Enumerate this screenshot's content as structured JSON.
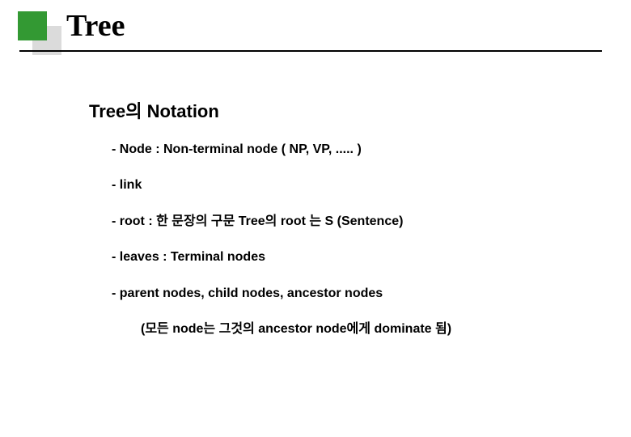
{
  "title": "Tree",
  "subtitle": "Tree의  Notation",
  "items": [
    "- Node :  Non-terminal node ( NP, VP, ..... )",
    "- link",
    "- root  :  한 문장의 구문 Tree의  root 는 S (Sentence)",
    "- leaves :  Terminal nodes",
    "- parent nodes,  child nodes,  ancestor nodes"
  ],
  "subitem": "(모든 node는 그것의 ancestor node에게 dominate 됨)"
}
